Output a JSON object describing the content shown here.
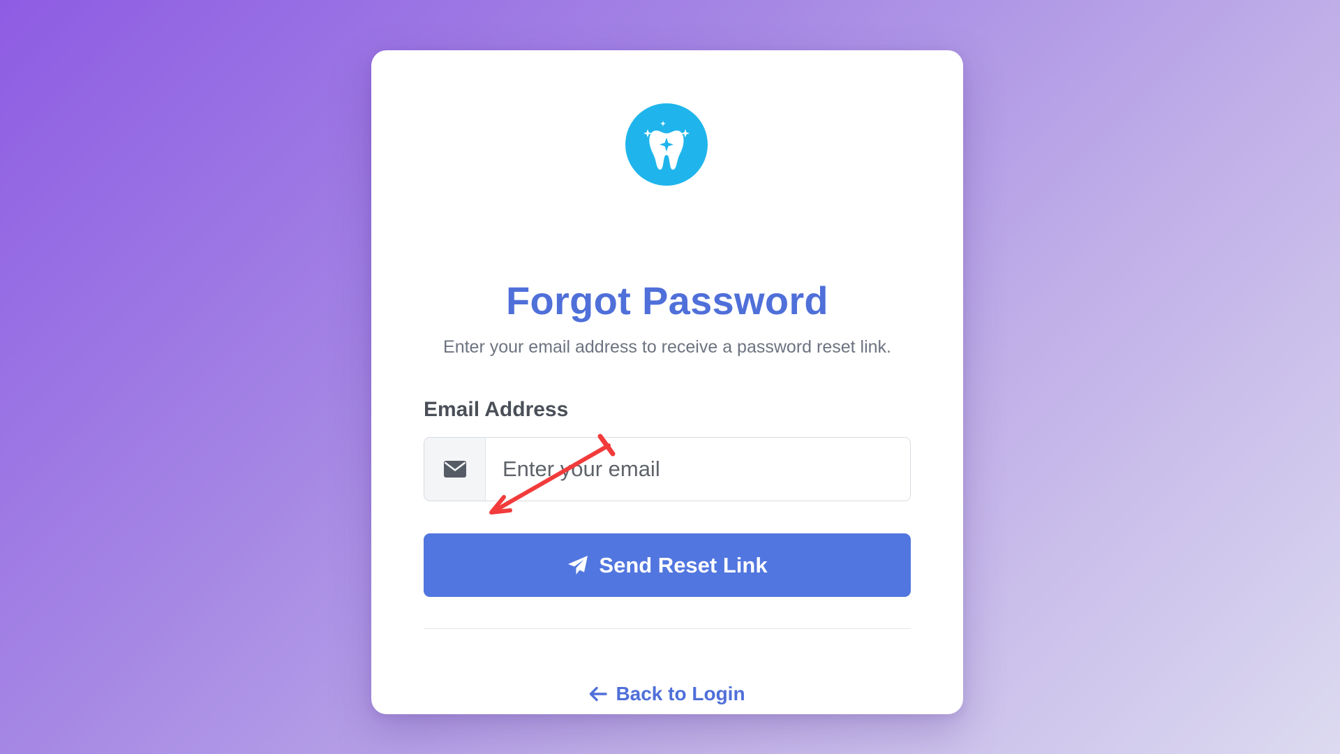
{
  "form": {
    "title": "Forgot Password",
    "subtitle": "Enter your email address to receive a password reset link.",
    "email_label": "Email Address",
    "email_placeholder": "Enter your email",
    "email_value": "",
    "submit_label": "Send Reset Link",
    "back_label": "Back to Login"
  },
  "icons": {
    "logo": "tooth-sparkle-icon",
    "email": "envelope-icon",
    "submit": "paper-plane-icon",
    "back": "arrow-left-icon"
  },
  "colors": {
    "primary": "#5176df",
    "title": "#4f6fd9",
    "logo_bg": "#1fb5ec",
    "annotation_arrow": "#f23b3b"
  }
}
